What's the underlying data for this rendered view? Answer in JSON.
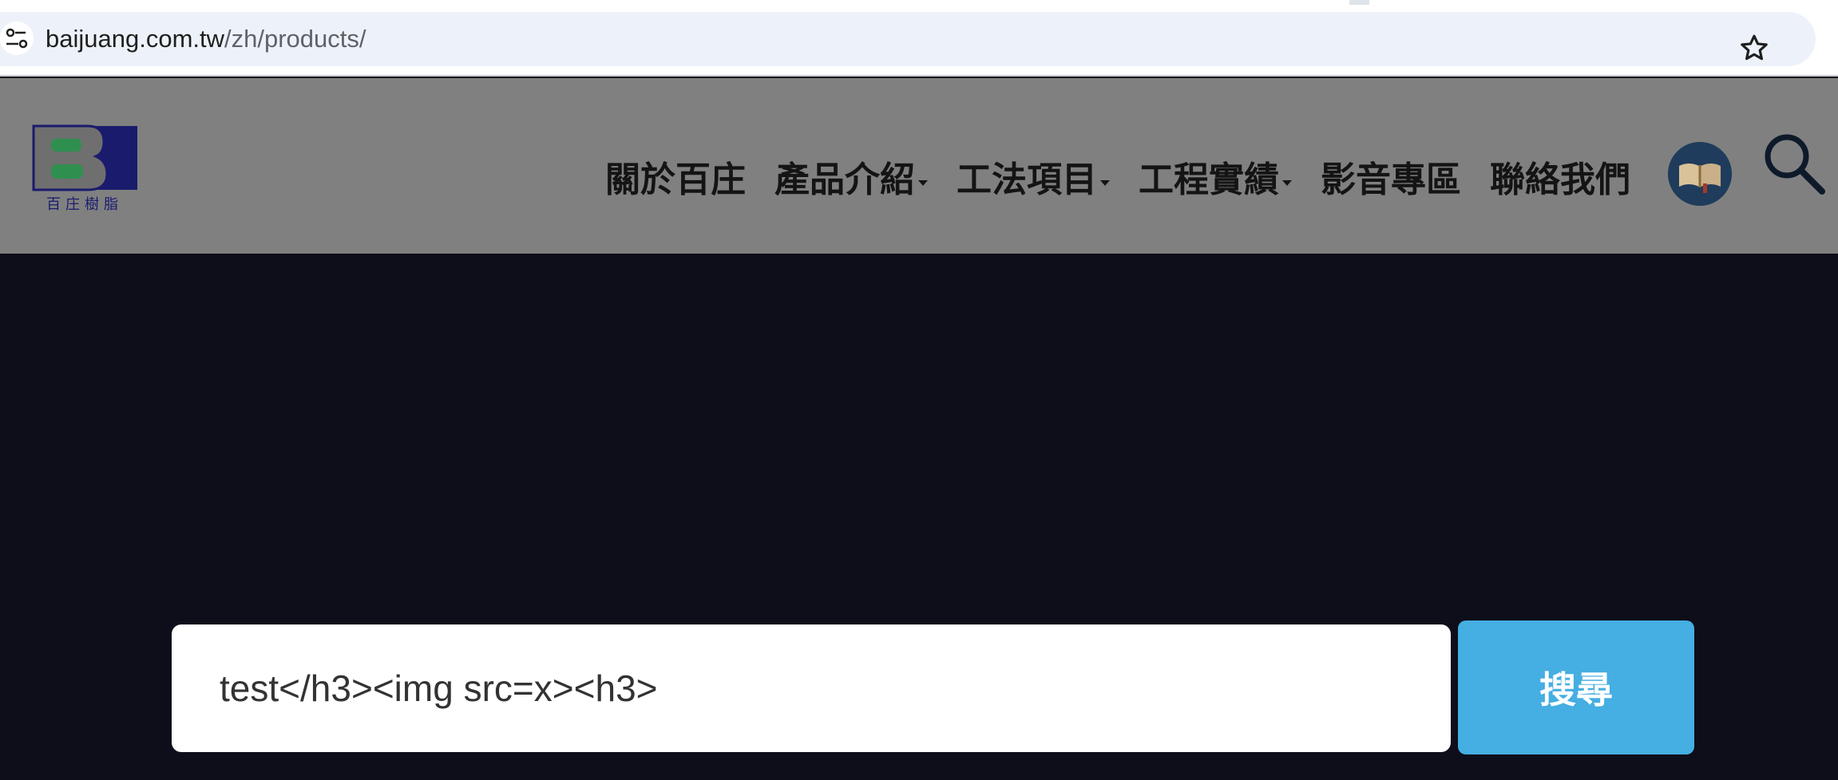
{
  "browser": {
    "url_host": "baijuang.com.tw",
    "url_path": "/zh/products/",
    "site_info_icon": "tune-icon",
    "bookmark_icon": "star-outline-icon"
  },
  "header": {
    "logo_text": "百庄樹脂",
    "nav": [
      {
        "label": "關於百庄",
        "dropdown": false
      },
      {
        "label": "產品介紹",
        "dropdown": true
      },
      {
        "label": "工法項目",
        "dropdown": true
      },
      {
        "label": "工程實績",
        "dropdown": true
      },
      {
        "label": "影音專區",
        "dropdown": false
      },
      {
        "label": "聯絡我們",
        "dropdown": false
      }
    ],
    "catalog_icon": "book-icon",
    "search_icon": "search-icon"
  },
  "search": {
    "value": "test</h3><img src=x><h3>",
    "button_label": "搜尋"
  },
  "colors": {
    "overlay_header": "#808080",
    "hero_bg": "#0e0e1a",
    "button_bg": "#45aee2",
    "logo_navy": "#1b1b6e",
    "logo_green": "#2f8f4f"
  }
}
